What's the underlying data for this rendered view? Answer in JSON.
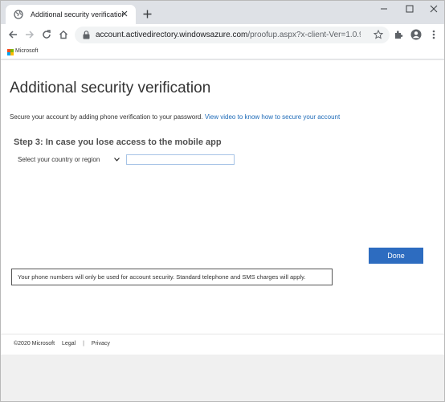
{
  "browser": {
    "tab_title": "Additional security verification",
    "url_main": "account.activedirectory.windowsazure.com",
    "url_path": "/proofup.aspx?x-client-Ver=1.0.9&x-c...",
    "brand_label": "Microsoft"
  },
  "page": {
    "title": "Additional security verification",
    "intro_text": "Secure your account by adding phone verification to your password.",
    "intro_link": "View video to know how to secure your account",
    "step_heading": "Step 3: In case you lose access to the mobile app",
    "country_select": "Select your country or region",
    "phone_value": "",
    "done_label": "Done",
    "notice": "Your phone numbers will only be used for account security. Standard telephone and SMS charges will apply."
  },
  "footer": {
    "copyright": "©2020 Microsoft",
    "legal": "Legal",
    "separator": "|",
    "privacy": "Privacy"
  },
  "colors": {
    "accent": "#2d6cc0",
    "link": "#1e6bb8",
    "ms_red": "#f25022",
    "ms_green": "#7fba00",
    "ms_blue": "#00a4ef",
    "ms_yellow": "#ffb900"
  }
}
